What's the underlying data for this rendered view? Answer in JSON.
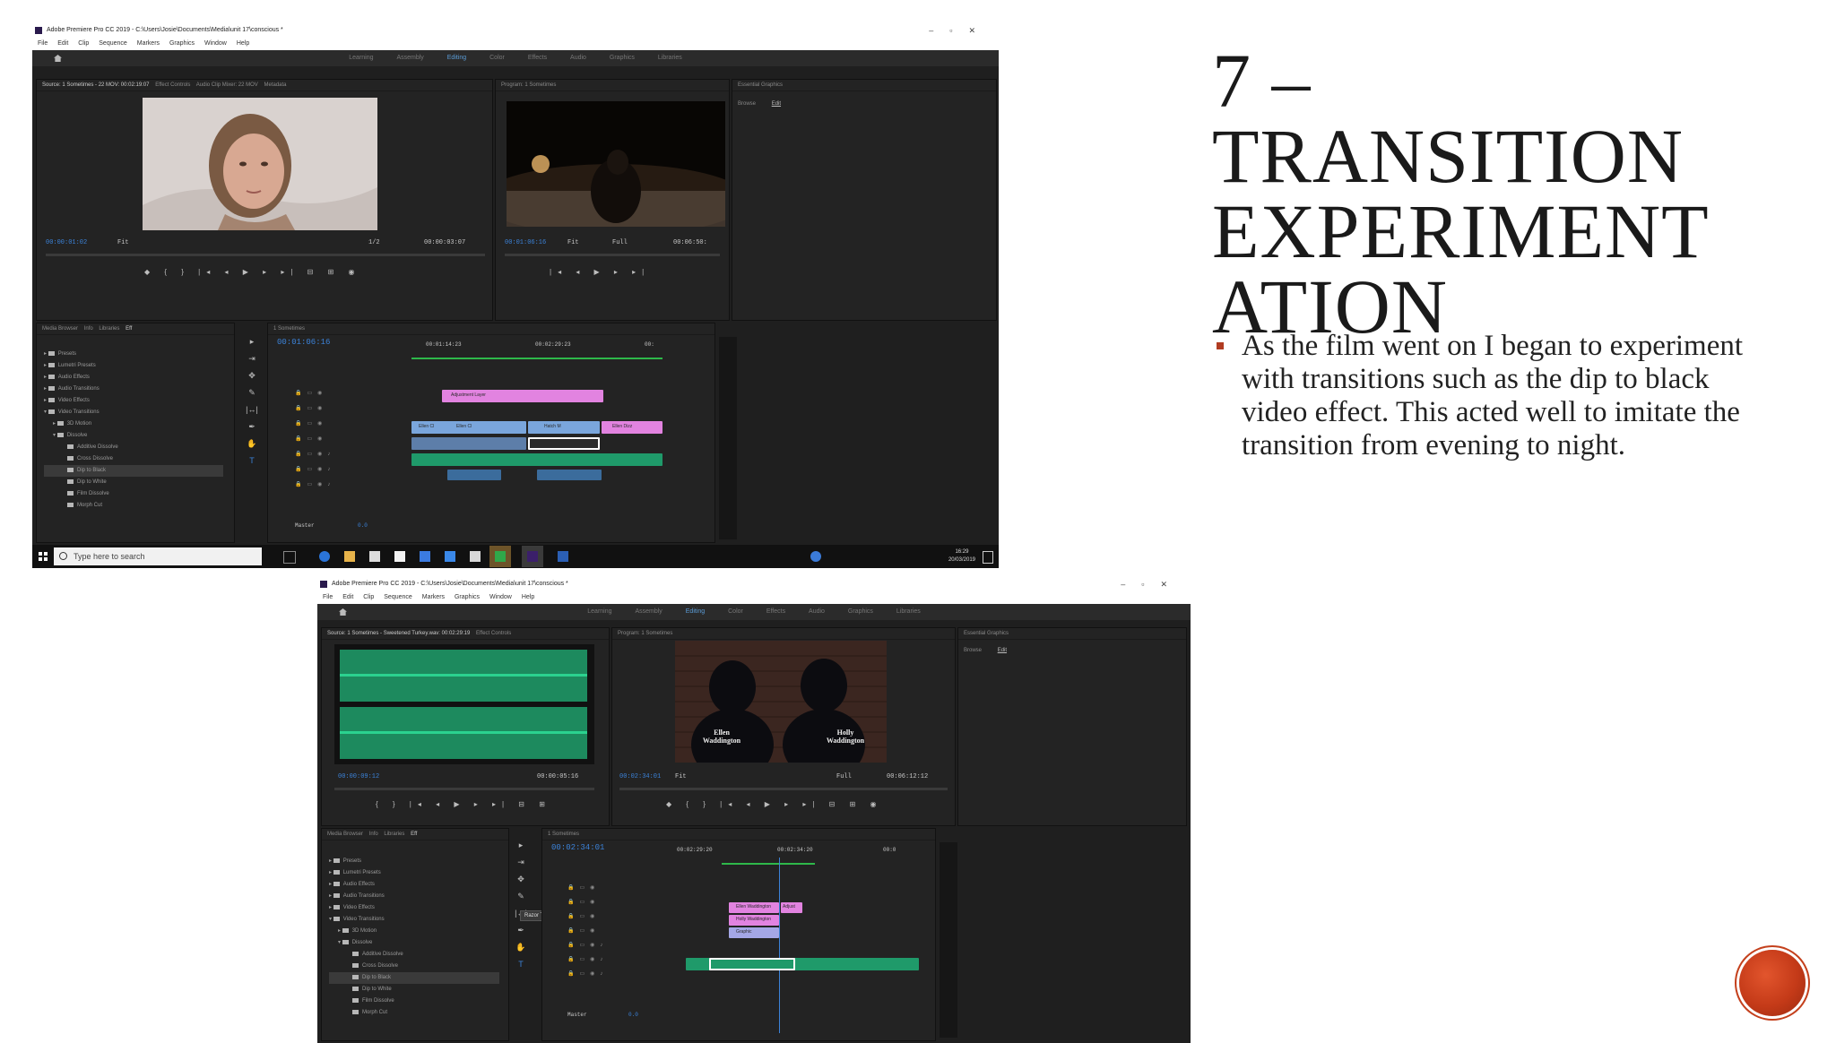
{
  "slide": {
    "title": "7 – TRANSITION EXPERIMENT ATION",
    "bullets": [
      "As the film went on I began to experiment with transitions such as the dip to black video effect. This acted well to imitate the transition from evening to night."
    ]
  },
  "screenshot1": {
    "window_title": "Adobe Premiere Pro CC 2019 - C:\\Users\\Josie\\Documents\\Media\\unit 17\\conscious *",
    "menu": [
      "File",
      "Edit",
      "Clip",
      "Sequence",
      "Markers",
      "Graphics",
      "Window",
      "Help"
    ],
    "workspaces": [
      "Learning",
      "Assembly",
      "Editing",
      "Color",
      "Effects",
      "Audio",
      "Graphics",
      "Libraries"
    ],
    "active_workspace": "Editing",
    "source_tabs": [
      "Source: 1 Sometimes - 22 MOV: 00:02:19:07",
      "Effect Controls",
      "Audio Clip Mixer: 22 MOV",
      "Metadata"
    ],
    "source_timecode": "00:00:01:02",
    "source_fit": "Fit",
    "source_ratio": "1/2",
    "source_duration": "00:00:03:07",
    "program_title": "Program: 1 Sometimes",
    "program_timecode": "00:01:06:16",
    "program_fit": "Fit",
    "program_quality": "Full",
    "program_duration": "00:06:50:",
    "essential_graphics": "Essential Graphics",
    "eg_tabs": [
      "Browse",
      "Edit"
    ],
    "project_tabs": [
      "Media Browser",
      "Info",
      "Libraries",
      "Eff"
    ],
    "effects_tree": [
      "Presets",
      "Lumetri Presets",
      "Audio Effects",
      "Audio Transitions",
      "Video Effects",
      "Video Transitions",
      "3D Motion",
      "Dissolve",
      "Additive Dissolve",
      "Cross Dissolve",
      "Dip to Black",
      "Dip to White",
      "Film Dissolve",
      "Morph Cut"
    ],
    "selected_effect": "Dip to Black",
    "sequence_tab": "1 Sometimes",
    "timeline_timecode": "00:01:06:16",
    "ruler": [
      "00:01:14:23",
      "00:02:29:23",
      "00:"
    ],
    "clip_labels": {
      "pink": "Adjustment Layer",
      "blue1": "Ellen Cl",
      "blue2": "Ellen Cl",
      "blue3": "Hatch M",
      "pink2": "Ellen Dizz"
    },
    "master": "Master",
    "master_value": "0.0",
    "taskbar_search": "Type here to search",
    "clock_time": "16:29",
    "clock_date": "20/03/2019"
  },
  "screenshot2": {
    "window_title": "Adobe Premiere Pro CC 2019 - C:\\Users\\Josie\\Documents\\Media\\unit 17\\conscious *",
    "menu": [
      "File",
      "Edit",
      "Clip",
      "Sequence",
      "Markers",
      "Graphics",
      "Window",
      "Help"
    ],
    "workspaces": [
      "Learning",
      "Assembly",
      "Editing",
      "Color",
      "Effects",
      "Audio",
      "Graphics",
      "Libraries"
    ],
    "active_workspace": "Editing",
    "source_tabs": [
      "Source: 1 Sometimes - Sweetened Turkey.wav: 00:02:29:19",
      "Effect Controls"
    ],
    "source_timecode": "00:00:09:12",
    "source_duration": "00:00:05:16",
    "program_title": "Program: 1 Sometimes",
    "program_timecode": "00:02:34:01",
    "program_fit": "Fit",
    "program_quality": "Full",
    "program_duration": "00:06:12:12",
    "caption_left": "Ellen Waddington",
    "caption_right": "Holly Waddington",
    "essential_graphics": "Essential Graphics",
    "eg_tabs": [
      "Browse",
      "Edit"
    ],
    "project_tabs": [
      "Media Browser",
      "Info",
      "Libraries",
      "Eff"
    ],
    "effects_tree": [
      "Presets",
      "Lumetri Presets",
      "Audio Effects",
      "Audio Transitions",
      "Video Effects",
      "Video Transitions",
      "3D Motion",
      "Dissolve",
      "Additive Dissolve",
      "Cross Dissolve",
      "Dip to Black",
      "Dip to White",
      "Film Dissolve",
      "Morph Cut"
    ],
    "selected_effect": "Dip to Black",
    "tooltip": "Razor Tool (C)",
    "sequence_tab": "1 Sometimes",
    "timeline_timecode": "00:02:34:01",
    "ruler": [
      "00:02:29:20",
      "00:02:34:20",
      "00:0"
    ],
    "clip_labels": {
      "pink1": "Ellen Waddington",
      "pink2": "Holly Waddington",
      "lav": "Graphic",
      "pink3": "Adjust"
    },
    "master": "Master",
    "master_value": "0.0"
  },
  "colors": {
    "title_text": "#1a1a1a",
    "bullet_marker": "#b13c22",
    "premiere_blue": "#3b82d8",
    "clip_pink": "#e283e0",
    "clip_blue": "#7aa6dc",
    "clip_green": "#1f9a6a"
  }
}
